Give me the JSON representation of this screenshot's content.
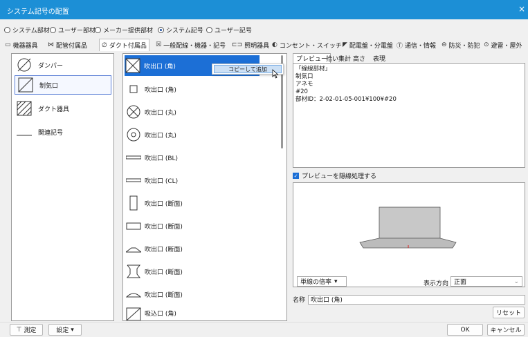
{
  "window": {
    "title": "システム記号の配置",
    "close": "×"
  },
  "radios": [
    {
      "label": "システム部材",
      "checked": false
    },
    {
      "label": "ユーザー部材",
      "checked": false
    },
    {
      "label": "メーカー提供部材",
      "checked": false
    },
    {
      "label": "システム記号",
      "checked": true
    },
    {
      "label": "ユーザー記号",
      "checked": false
    }
  ],
  "tabs": [
    {
      "label": "機器器具",
      "icon": "▭"
    },
    {
      "label": "配管付属品",
      "icon": "⋈"
    },
    {
      "label": "ダクト付属品",
      "icon": "∅"
    },
    {
      "label": "一般配線・機器・記号",
      "icon": "☒"
    },
    {
      "label": "照明器具",
      "icon": "⊏⊐"
    },
    {
      "label": "コンセント・スイッチ",
      "icon": "◐"
    },
    {
      "label": "配電盤・分電盤",
      "icon": "◤"
    },
    {
      "label": "通信・情報",
      "icon": "Ⓣ"
    },
    {
      "label": "防災・防犯",
      "icon": "⊖"
    },
    {
      "label": "避雷・屋外",
      "icon": "⊙"
    }
  ],
  "left_list": [
    {
      "label": "ダンパー"
    },
    {
      "label": "制気口"
    },
    {
      "label": "ダクト器具"
    },
    {
      "label": "関連記号"
    }
  ],
  "mid_list": [
    {
      "label": "吹出口 (角)"
    },
    {
      "label": "吹出口 (角)"
    },
    {
      "label": "吹出口 (丸)"
    },
    {
      "label": "吹出口 (丸)"
    },
    {
      "label": "吹出口 (BL)"
    },
    {
      "label": "吹出口 (CL)"
    },
    {
      "label": "吹出口 (断面)"
    },
    {
      "label": "吹出口 (断面)"
    },
    {
      "label": "吹出口 (断面)"
    },
    {
      "label": "吹出口 (断面)"
    },
    {
      "label": "吹出口 (断面)"
    },
    {
      "label": "吸込口 (角)"
    }
  ],
  "context_menu": {
    "item": "コピーして追加"
  },
  "preview_tabs": [
    "プレビュー",
    "拾い集計",
    "高さ",
    "表現"
  ],
  "preview_text": [
    "「線線部材」",
    "制気口",
    "アネモ",
    "#20",
    "部材ID：2-02-01-05-001¥100¥#20"
  ],
  "hidden_line_label": "プレビューを隠線処理する",
  "scale_combo": "単線の倍率",
  "direction_label": "表示方向",
  "direction_value": "正面",
  "name_label": "名称",
  "name_value": "吹出口 (角)",
  "reset_button": "リセット",
  "measure_button": "測定",
  "settings_button": "設定",
  "ok_button": "OK",
  "cancel_button": "キャンセル",
  "colors": {
    "titlebar": "#1c8fd6",
    "selection": "#1c6fd6"
  }
}
